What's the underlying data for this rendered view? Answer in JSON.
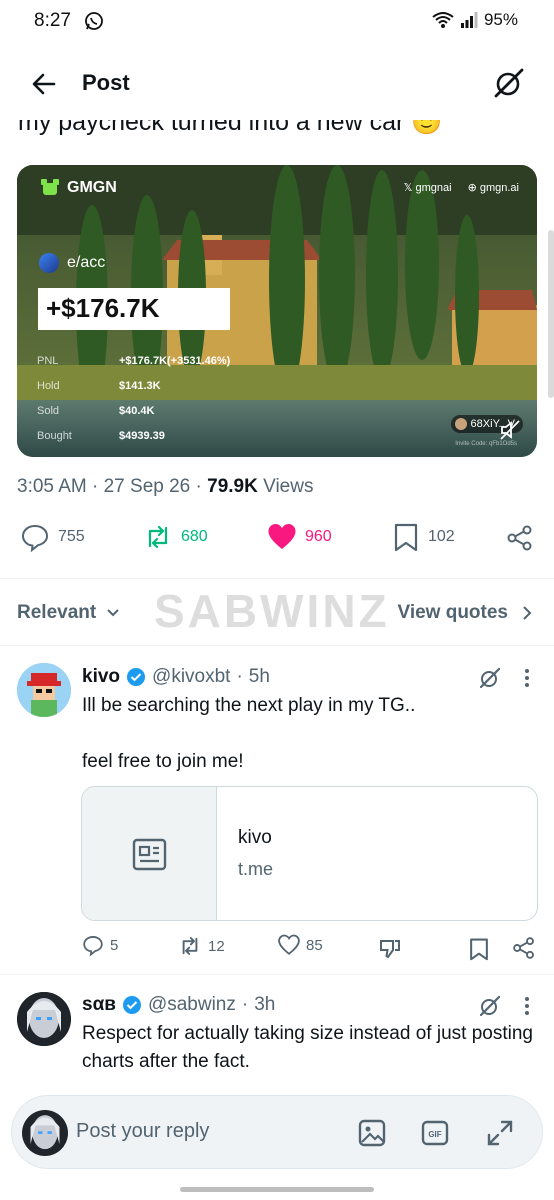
{
  "status_bar": {
    "time": "8:27",
    "battery": "95%"
  },
  "header": {
    "title": "Post"
  },
  "post": {
    "text_partial": "my paycheck turned into a new car 🙂",
    "media": {
      "brand": "GMGN",
      "links": [
        "gmgnai",
        "gmgn.ai"
      ],
      "account": "e/acc",
      "pnl_big": "+$176.7K",
      "stats": [
        {
          "label": "PNL",
          "value": "+$176.7K(+3531.46%)"
        },
        {
          "label": "Hold",
          "value": "$141.3K"
        },
        {
          "label": "Sold",
          "value": "$40.4K"
        },
        {
          "label": "Bought",
          "value": "$4939.39"
        }
      ],
      "address": "68XiY...V",
      "invite": "Invite Code: qFb1Od5s"
    },
    "time": "3:05 AM",
    "date": "27 Sep 26",
    "views_count": "79.9K",
    "views_label": "Views",
    "actions": {
      "replies": "755",
      "reposts": "680",
      "likes": "960",
      "bookmarks": "102"
    },
    "colors": {
      "repost": "#00ba7c",
      "like": "#f91880",
      "verified": "#1d9bf0"
    }
  },
  "sort": {
    "label": "Relevant",
    "view_quotes": "View quotes"
  },
  "watermark": "SABWINZ",
  "replies": [
    {
      "name": "kivo",
      "handle": "@kivoxbt",
      "time": "5h",
      "text": "Ill be searching the next play in my TG..\n\nfeel free to join me!",
      "link_card": {
        "title": "kivo",
        "domain": "t.me"
      },
      "actions": {
        "replies": "5",
        "reposts": "12",
        "likes": "85"
      }
    },
    {
      "name": "sαв",
      "handle": "@sabwinz",
      "time": "3h",
      "text": "Respect for actually taking size instead of just posting charts after the fact."
    }
  ],
  "composer": {
    "placeholder": "Post your reply"
  }
}
